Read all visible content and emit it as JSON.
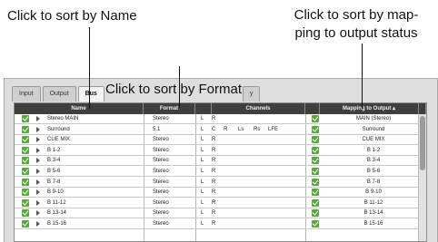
{
  "callouts": {
    "name": "Click to sort by Name",
    "map_line1": "Click to sort by map-",
    "map_line2": "ping to output status",
    "format": "Click to sort by Format"
  },
  "tabs": [
    {
      "label": "Input"
    },
    {
      "label": "Output"
    },
    {
      "label": "Bus"
    }
  ],
  "tab_obscured_fragment": "y",
  "columns": {
    "name": "Name",
    "format": "Format",
    "channels": "Channels",
    "mapping": "Mapping to Output ▴"
  },
  "rows": [
    {
      "name": "Stereo MAIN",
      "format": "Stereo",
      "channels": [
        "L",
        "R"
      ],
      "mapping": "MAIN (Stereo)",
      "expandable": true
    },
    {
      "name": "Surround",
      "format": "5.1",
      "channels": [
        "L",
        "C",
        "R",
        "Ls",
        "Rs",
        "LFE"
      ],
      "mapping": "Surround",
      "expandable": true
    },
    {
      "name": "CUE MIX",
      "format": "Stereo",
      "channels": [
        "L",
        "R"
      ],
      "mapping": "CUE MIX",
      "expandable": true
    },
    {
      "name": "B 1-2",
      "format": "Stereo",
      "channels": [
        "L",
        "R"
      ],
      "mapping": "B 1-2",
      "expandable": true
    },
    {
      "name": "B 3-4",
      "format": "Stereo",
      "channels": [
        "L",
        "R"
      ],
      "mapping": "B 3-4",
      "expandable": true
    },
    {
      "name": "B 5-6",
      "format": "Stereo",
      "channels": [
        "L",
        "R"
      ],
      "mapping": "B 5-6",
      "expandable": true
    },
    {
      "name": "B 7-8",
      "format": "Stereo",
      "channels": [
        "L",
        "R"
      ],
      "mapping": "B 7-8",
      "expandable": true
    },
    {
      "name": "B 9-10",
      "format": "Stereo",
      "channels": [
        "L",
        "R"
      ],
      "mapping": "B 9-10",
      "expandable": true
    },
    {
      "name": "B 11-12",
      "format": "Stereo",
      "channels": [
        "L",
        "R"
      ],
      "mapping": "B 11-12",
      "expandable": true
    },
    {
      "name": "B 13-14",
      "format": "Stereo",
      "channels": [
        "L",
        "R"
      ],
      "mapping": "B 13-14",
      "expandable": true
    },
    {
      "name": "B 15-16",
      "format": "Stereo",
      "channels": [
        "L",
        "R"
      ],
      "mapping": "B 15-16",
      "expandable": true
    }
  ],
  "colors": {
    "header_bg": "#3f3f3f",
    "check_green": "#56a93a",
    "window_bg": "#dedede"
  }
}
